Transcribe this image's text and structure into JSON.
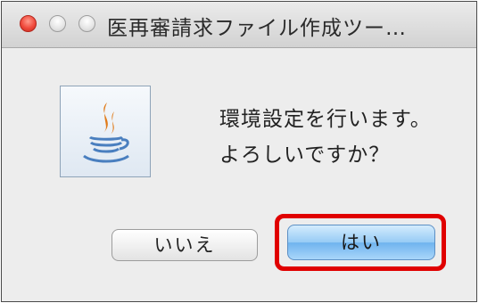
{
  "window": {
    "title": "医再審請求ファイル作成ツー…"
  },
  "dialog": {
    "icon": "java-coffee-cup-icon",
    "message_line1": "環境設定を行います。",
    "message_line2": "よろしいですか？"
  },
  "buttons": {
    "no_label": "いいえ",
    "yes_label": "はい"
  },
  "colors": {
    "highlight": "#e00000",
    "close_light": "#f04a3c",
    "default_button": "#96cbf5"
  }
}
